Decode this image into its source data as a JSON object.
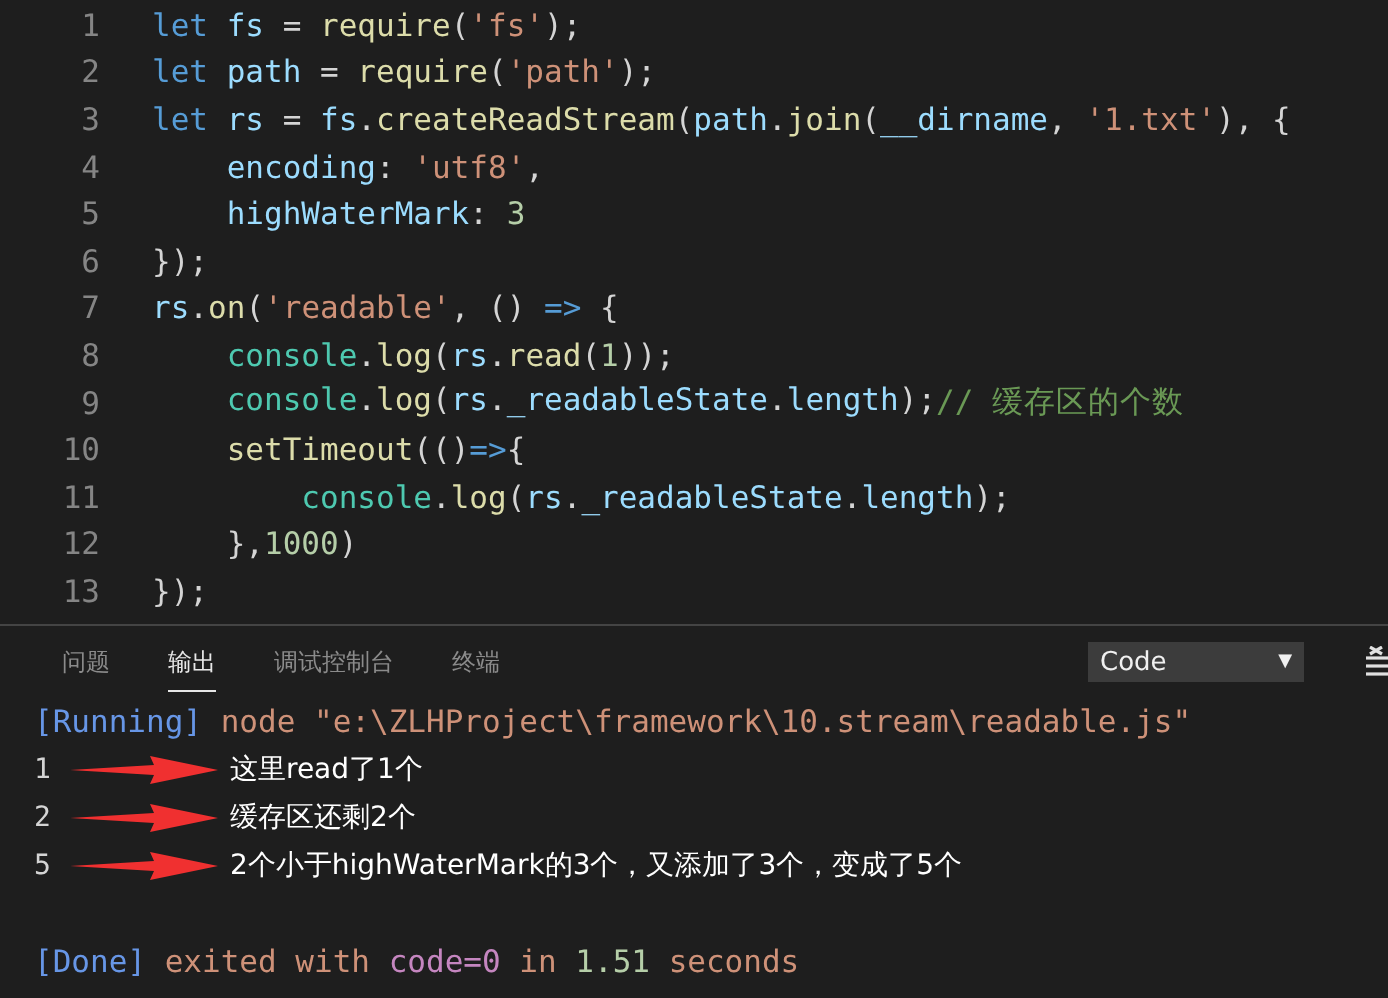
{
  "editor": {
    "lines": [
      {
        "number": "1",
        "tokens": [
          {
            "kind": "kw",
            "text": "let "
          },
          {
            "kind": "var",
            "text": "fs"
          },
          {
            "kind": "punc",
            "text": " = "
          },
          {
            "kind": "fn",
            "text": "require"
          },
          {
            "kind": "punc",
            "text": "("
          },
          {
            "kind": "str",
            "text": "'fs'"
          },
          {
            "kind": "punc",
            "text": ");"
          }
        ]
      },
      {
        "number": "2",
        "tokens": [
          {
            "kind": "kw",
            "text": "let "
          },
          {
            "kind": "var",
            "text": "path"
          },
          {
            "kind": "punc",
            "text": " = "
          },
          {
            "kind": "fn",
            "text": "require"
          },
          {
            "kind": "punc",
            "text": "("
          },
          {
            "kind": "str",
            "text": "'path'"
          },
          {
            "kind": "punc",
            "text": ");"
          }
        ]
      },
      {
        "number": "3",
        "tokens": [
          {
            "kind": "kw",
            "text": "let "
          },
          {
            "kind": "var",
            "text": "rs"
          },
          {
            "kind": "punc",
            "text": " = "
          },
          {
            "kind": "var",
            "text": "fs"
          },
          {
            "kind": "punc",
            "text": "."
          },
          {
            "kind": "fn",
            "text": "createReadStream"
          },
          {
            "kind": "punc",
            "text": "("
          },
          {
            "kind": "var",
            "text": "path"
          },
          {
            "kind": "punc",
            "text": "."
          },
          {
            "kind": "fn",
            "text": "join"
          },
          {
            "kind": "punc",
            "text": "("
          },
          {
            "kind": "var",
            "text": "__dirname"
          },
          {
            "kind": "punc",
            "text": ", "
          },
          {
            "kind": "str",
            "text": "'1.txt'"
          },
          {
            "kind": "punc",
            "text": "), {"
          }
        ]
      },
      {
        "number": "4",
        "tokens": [
          {
            "kind": "var",
            "text": "    encoding"
          },
          {
            "kind": "punc",
            "text": ": "
          },
          {
            "kind": "str",
            "text": "'utf8'"
          },
          {
            "kind": "punc",
            "text": ","
          }
        ]
      },
      {
        "number": "5",
        "tokens": [
          {
            "kind": "var",
            "text": "    highWaterMark"
          },
          {
            "kind": "punc",
            "text": ": "
          },
          {
            "kind": "num",
            "text": "3"
          }
        ]
      },
      {
        "number": "6",
        "tokens": [
          {
            "kind": "punc",
            "text": "});"
          }
        ]
      },
      {
        "number": "7",
        "tokens": [
          {
            "kind": "var",
            "text": "rs"
          },
          {
            "kind": "punc",
            "text": "."
          },
          {
            "kind": "fn",
            "text": "on"
          },
          {
            "kind": "punc",
            "text": "("
          },
          {
            "kind": "str",
            "text": "'readable'"
          },
          {
            "kind": "punc",
            "text": ", () "
          },
          {
            "kind": "kw",
            "text": "=>"
          },
          {
            "kind": "punc",
            "text": " {"
          }
        ]
      },
      {
        "number": "8",
        "tokens": [
          {
            "kind": "obj",
            "text": "    console"
          },
          {
            "kind": "punc",
            "text": "."
          },
          {
            "kind": "fn",
            "text": "log"
          },
          {
            "kind": "punc",
            "text": "("
          },
          {
            "kind": "var",
            "text": "rs"
          },
          {
            "kind": "punc",
            "text": "."
          },
          {
            "kind": "fn",
            "text": "read"
          },
          {
            "kind": "punc",
            "text": "("
          },
          {
            "kind": "num",
            "text": "1"
          },
          {
            "kind": "punc",
            "text": "));"
          }
        ]
      },
      {
        "number": "9",
        "tokens": [
          {
            "kind": "obj",
            "text": "    console"
          },
          {
            "kind": "punc",
            "text": "."
          },
          {
            "kind": "fn",
            "text": "log"
          },
          {
            "kind": "punc",
            "text": "("
          },
          {
            "kind": "var",
            "text": "rs"
          },
          {
            "kind": "punc",
            "text": "."
          },
          {
            "kind": "var",
            "text": "_readableState"
          },
          {
            "kind": "punc",
            "text": "."
          },
          {
            "kind": "var",
            "text": "length"
          },
          {
            "kind": "punc",
            "text": ");"
          },
          {
            "kind": "comment",
            "text": "// 缓存区的个数"
          }
        ]
      },
      {
        "number": "10",
        "tokens": [
          {
            "kind": "fn",
            "text": "    setTimeout"
          },
          {
            "kind": "punc",
            "text": "(()"
          },
          {
            "kind": "kw",
            "text": "=>"
          },
          {
            "kind": "punc",
            "text": "{"
          }
        ]
      },
      {
        "number": "11",
        "tokens": [
          {
            "kind": "obj",
            "text": "        console"
          },
          {
            "kind": "punc",
            "text": "."
          },
          {
            "kind": "fn",
            "text": "log"
          },
          {
            "kind": "punc",
            "text": "("
          },
          {
            "kind": "var",
            "text": "rs"
          },
          {
            "kind": "punc",
            "text": "."
          },
          {
            "kind": "var",
            "text": "_readableState"
          },
          {
            "kind": "punc",
            "text": "."
          },
          {
            "kind": "var",
            "text": "length"
          },
          {
            "kind": "punc",
            "text": ");"
          }
        ]
      },
      {
        "number": "12",
        "tokens": [
          {
            "kind": "punc",
            "text": "    },"
          },
          {
            "kind": "num",
            "text": "1000"
          },
          {
            "kind": "punc",
            "text": ")"
          }
        ]
      },
      {
        "number": "13",
        "tokens": [
          {
            "kind": "punc",
            "text": "});"
          }
        ]
      }
    ]
  },
  "panel": {
    "tabs": [
      {
        "label": "问题",
        "selected": false
      },
      {
        "label": "输出",
        "selected": true
      },
      {
        "label": "调试控制台",
        "selected": false
      },
      {
        "label": "终端",
        "selected": false
      }
    ],
    "channel_dropdown": {
      "value": "Code",
      "caret": "▼"
    },
    "output": [
      {
        "kind": "run",
        "segments": [
          {
            "kind": "tag",
            "text": "[Running]"
          },
          {
            "kind": "plain",
            "text": " node \"e:\\ZLHProject\\framework\\10.stream\\readable.js\""
          }
        ]
      },
      {
        "kind": "result",
        "value": "1",
        "note": "这里read了1个"
      },
      {
        "kind": "result",
        "value": "2",
        "note": "缓存区还剩2个"
      },
      {
        "kind": "result",
        "value": "5",
        "note": "2个小于highWaterMark的3个，又添加了3个，变成了5个"
      },
      {
        "kind": "blank"
      },
      {
        "kind": "run",
        "segments": [
          {
            "kind": "tag",
            "text": "[Done]"
          },
          {
            "kind": "plain",
            "text": " exited with "
          },
          {
            "kind": "code",
            "text": "code=0"
          },
          {
            "kind": "plain",
            "text": " in "
          },
          {
            "kind": "num",
            "text": "1.51"
          },
          {
            "kind": "plain",
            "text": " seconds"
          }
        ]
      }
    ]
  }
}
